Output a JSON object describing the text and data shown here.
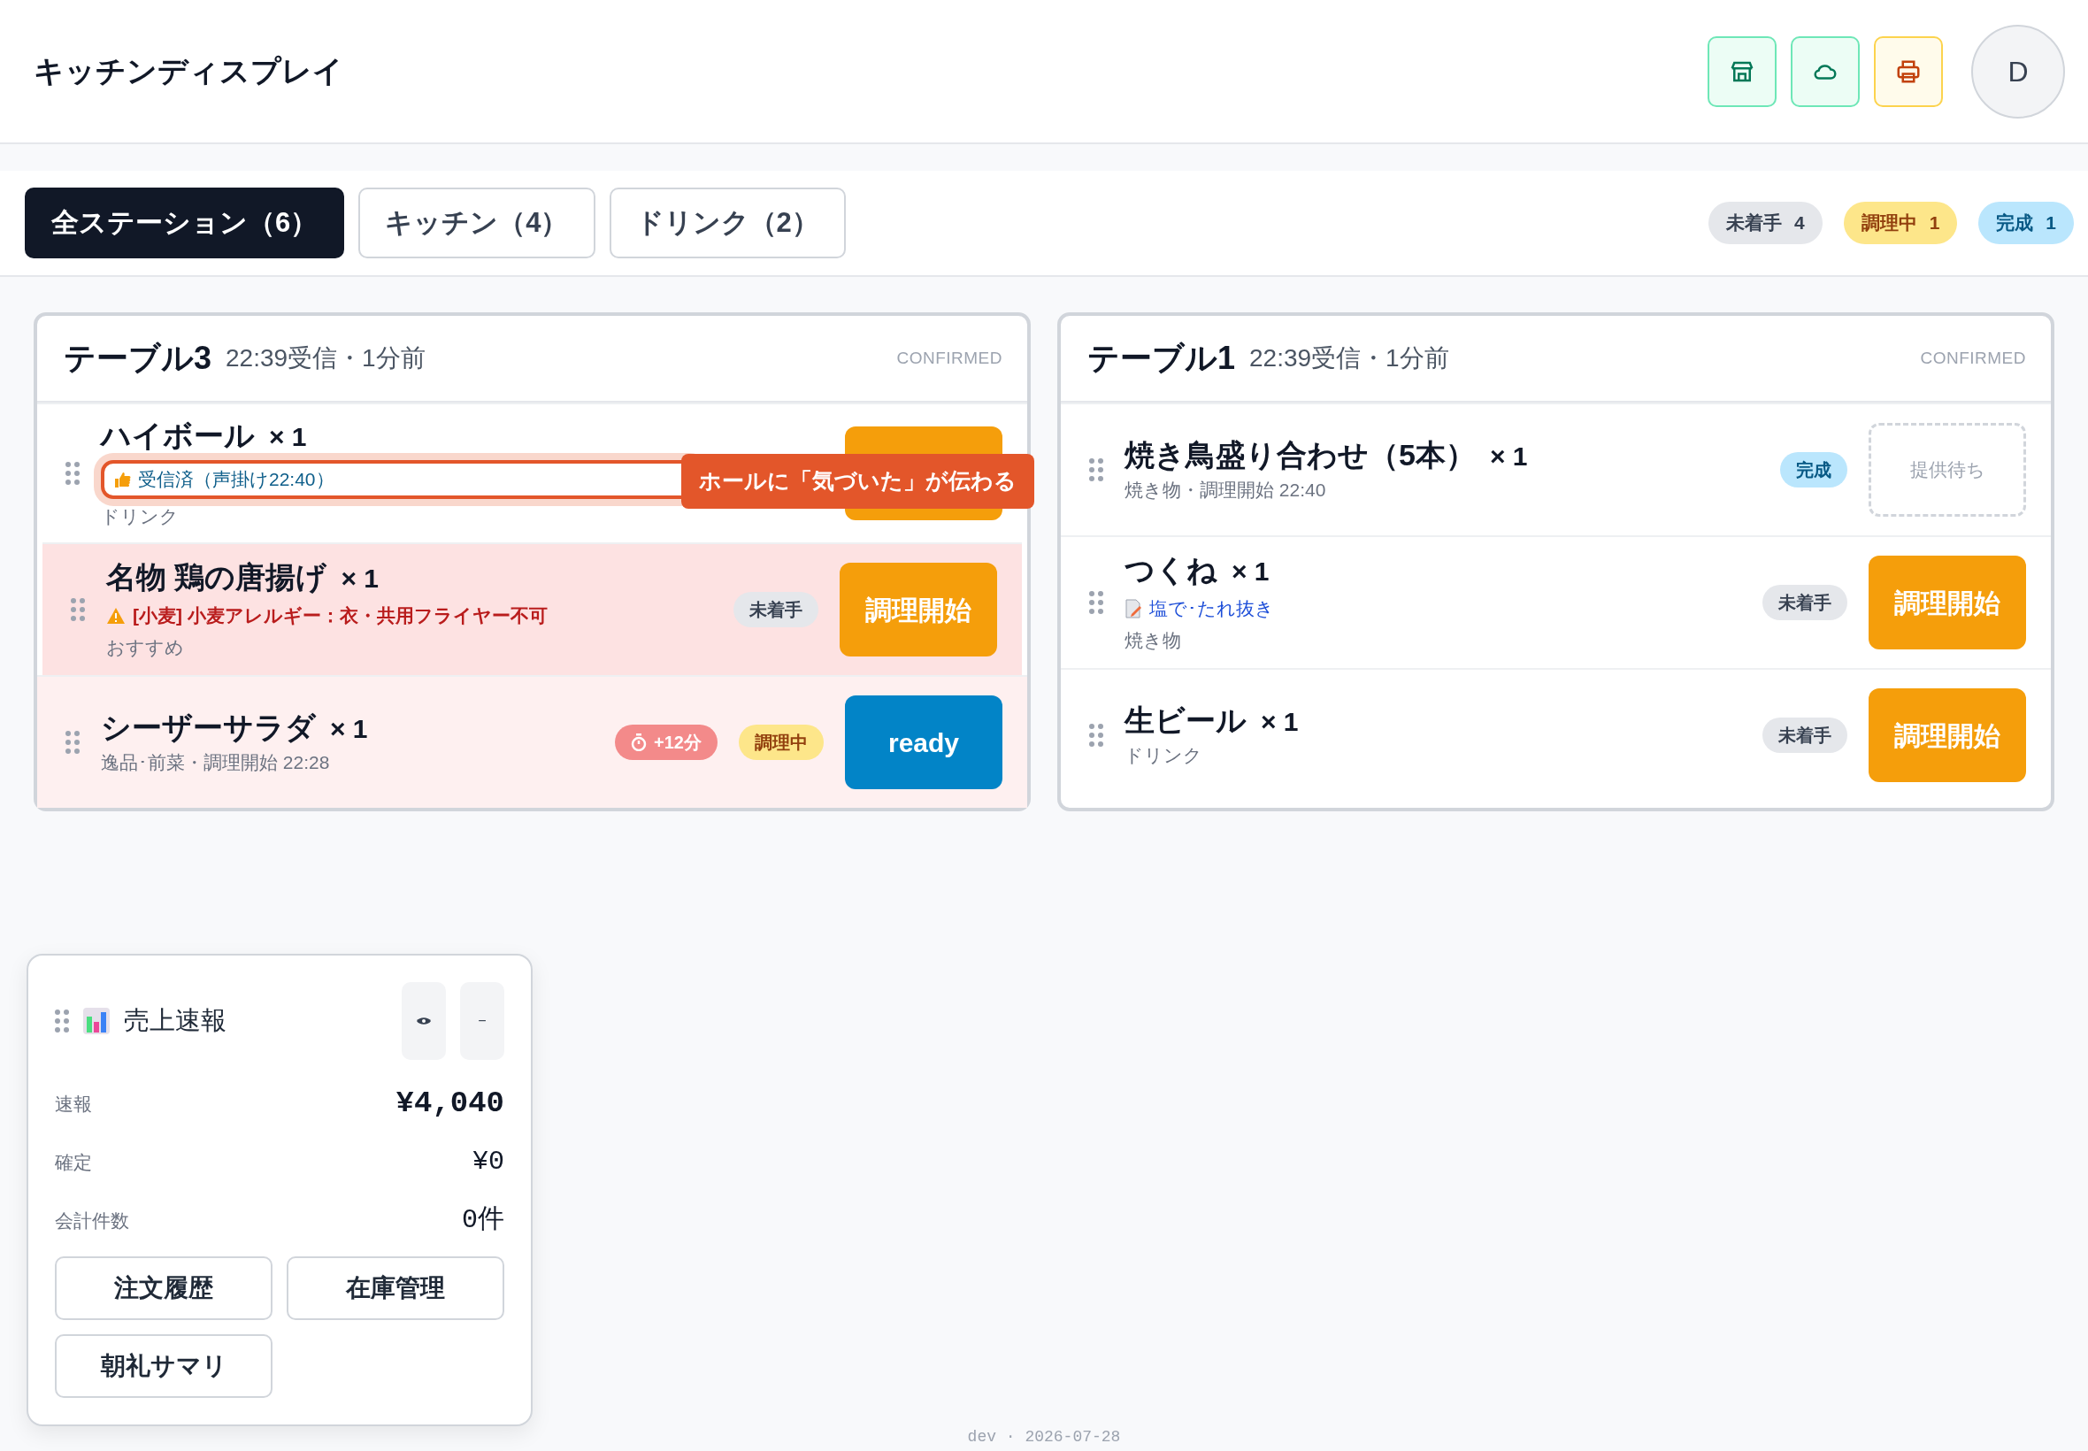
{
  "header": {
    "title": "キッチンディスプレイ",
    "icon_buttons": [
      {
        "kind": "store"
      },
      {
        "kind": "cloud"
      },
      {
        "kind": "printer"
      }
    ],
    "avatar": "D"
  },
  "tabs": [
    {
      "label": "全ステーション（6）",
      "selected": true
    },
    {
      "label": "キッチン（4）",
      "selected": false
    },
    {
      "label": "ドリンク（2）",
      "selected": false
    }
  ],
  "status_counts": [
    {
      "label": "未着手",
      "count": "4",
      "kind": "pending"
    },
    {
      "label": "調理中",
      "count": "1",
      "kind": "cooking"
    },
    {
      "label": "完成",
      "count": "1",
      "kind": "done"
    }
  ],
  "tables": [
    {
      "title": "テーブル3",
      "received": "22:39受信・1分前",
      "status": "CONFIRMED",
      "items": [
        {
          "name": "ハイボール",
          "qty": "× 1",
          "kind": "normal",
          "notes": [
            {
              "kind": "ack",
              "text": "受信済（声掛け22:40）",
              "highlighted": true
            }
          ],
          "detail": "ドリンク",
          "action": {
            "kind": "start"
          },
          "callout": "ホールに「気づいた」が伝わる"
        },
        {
          "name": "名物 鶏の唐揚げ",
          "qty": "× 1",
          "kind": "allergy",
          "notes": [
            {
              "kind": "allergy",
              "text": "[小麦] 小麦アレルギー：衣・共用フライヤー不可",
              "highlighted": false
            }
          ],
          "detail": "おすすめ",
          "status": {
            "label": "未着手",
            "kind": "pending"
          },
          "action": {
            "kind": "start",
            "label": "調理開始"
          }
        },
        {
          "name": "シーザーサラダ",
          "qty": "× 1",
          "kind": "overdue",
          "detail": "逸品･前菜・調理開始 22:28",
          "overdue": "+12分",
          "status": {
            "label": "調理中",
            "kind": "cooking"
          },
          "action": {
            "kind": "ready",
            "label": "ready"
          }
        }
      ]
    },
    {
      "title": "テーブル1",
      "received": "22:39受信・1分前",
      "status": "CONFIRMED",
      "items": [
        {
          "name": "焼き鳥盛り合わせ（5本）",
          "qty": "× 1",
          "kind": "normal",
          "detail": "焼き物・調理開始 22:40",
          "status": {
            "label": "完成",
            "kind": "done"
          },
          "action": {
            "kind": "waiting",
            "label": "提供待ち"
          }
        },
        {
          "name": "つくね",
          "qty": "× 1",
          "kind": "normal",
          "notes": [
            {
              "kind": "memo",
              "text": "塩で･たれ抜き",
              "highlighted": false
            }
          ],
          "detail": "焼き物",
          "status": {
            "label": "未着手",
            "kind": "pending"
          },
          "action": {
            "kind": "start",
            "label": "調理開始"
          }
        },
        {
          "name": "生ビール",
          "qty": "× 1",
          "kind": "normal",
          "detail": "ドリンク",
          "status": {
            "label": "未着手",
            "kind": "pending"
          },
          "action": {
            "kind": "start",
            "label": "調理開始"
          }
        }
      ]
    }
  ],
  "widget": {
    "title": "売上速報",
    "minimize": "−",
    "rows": [
      {
        "label": "速報",
        "value": "¥4,040",
        "emphasis": true
      },
      {
        "label": "確定",
        "value": "¥0",
        "emphasis": false
      },
      {
        "label": "会計件数",
        "value": "0件",
        "emphasis": false
      }
    ],
    "buttons": [
      "注文履歴",
      "在庫管理",
      "朝礼サマリ"
    ]
  },
  "footer": "dev · 2026-07-28"
}
